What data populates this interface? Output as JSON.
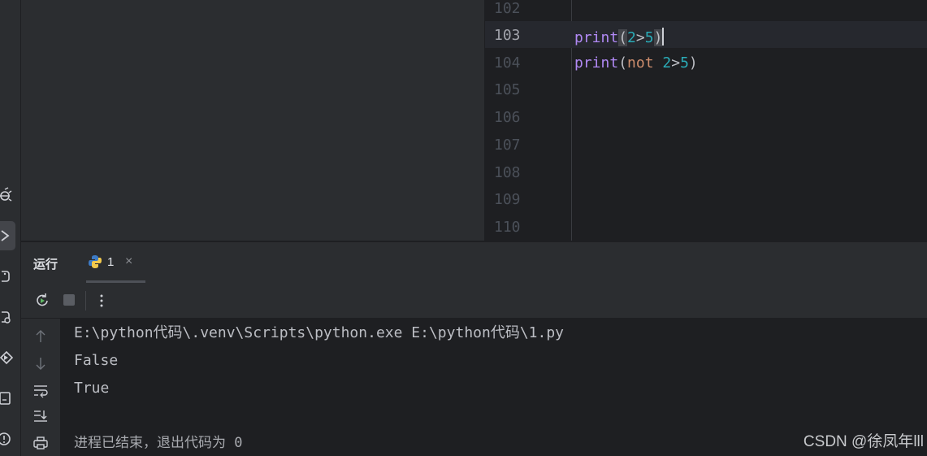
{
  "editor": {
    "lines": [
      {
        "num": "102"
      },
      {
        "num": "103",
        "active": true
      },
      {
        "num": "104"
      },
      {
        "num": "105"
      },
      {
        "num": "106"
      },
      {
        "num": "107"
      },
      {
        "num": "108"
      },
      {
        "num": "109"
      },
      {
        "num": "110"
      }
    ],
    "code": {
      "line103": {
        "fn": "print",
        "open": "(",
        "a": "2",
        "op": ">",
        "b": "5",
        "close": ")"
      },
      "line104": {
        "fn": "print",
        "open": "(",
        "kw": "not",
        "a": "2",
        "op": ">",
        "b": "5",
        "close": ")"
      }
    }
  },
  "tool_window": {
    "title": "运行",
    "tab_label": "1",
    "tab_close": "×"
  },
  "console": {
    "lines": [
      "E:\\python代码\\.venv\\Scripts\\python.exe E:\\python代码\\1.py",
      "False",
      "True",
      "",
      "进程已结束，退出代码为 0"
    ]
  },
  "watermark": "CSDN @徐凤年lll",
  "icons": {
    "left_strip": [
      "bug-icon",
      "run-icon",
      "python-packages-icon",
      "python-console-icon",
      "services-icon",
      "terminal-icon",
      "problems-icon"
    ],
    "toolbar": [
      "rerun-icon",
      "stop-icon",
      "more-options-icon"
    ],
    "console_gutter": [
      "scroll-up-icon",
      "scroll-down-icon",
      "soft-wrap-icon",
      "scroll-to-end-icon",
      "print-icon"
    ]
  }
}
